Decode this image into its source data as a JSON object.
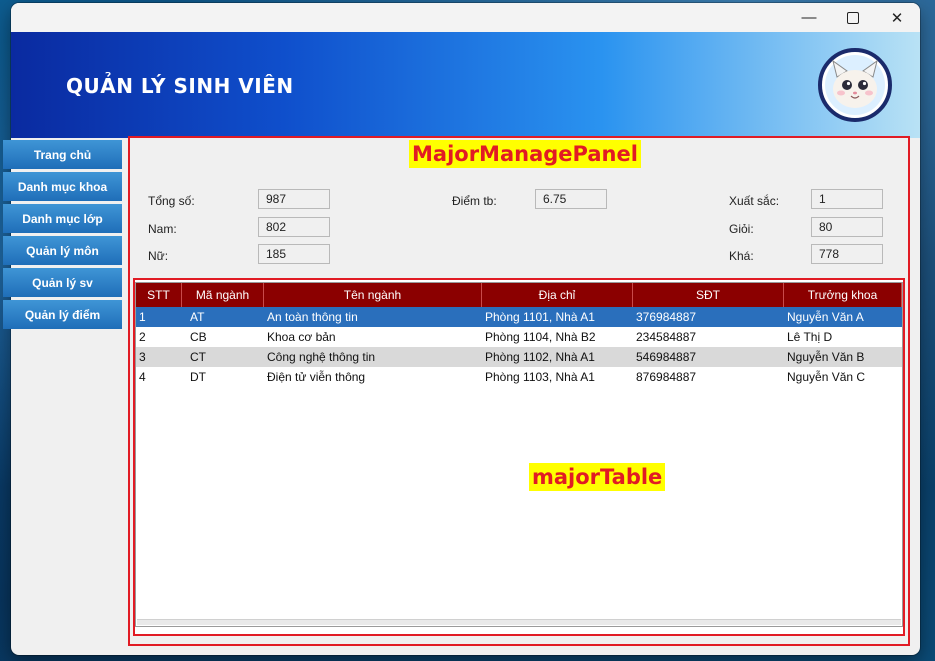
{
  "window": {
    "controls": {
      "minimize": "—",
      "close": "✕"
    }
  },
  "header": {
    "title": "QUẢN LÝ SINH VIÊN",
    "logo_icon": "cat-mascot-icon"
  },
  "sidebar": {
    "items": [
      {
        "label": "Trang chủ"
      },
      {
        "label": "Danh mục khoa"
      },
      {
        "label": "Danh mục lớp"
      },
      {
        "label": "Quản lý môn"
      },
      {
        "label": "Quản lý sv"
      },
      {
        "label": "Quản lý điểm"
      }
    ]
  },
  "annotations": {
    "panel": "MajorManagePanel",
    "table": "majorTable"
  },
  "stats": {
    "total_label": "Tổng số:",
    "total": "987",
    "male_label": "Nam:",
    "male": "802",
    "female_label": "Nữ:",
    "female": "185",
    "avg_label": "Điểm tb:",
    "avg": "6.75",
    "excellent_label": "Xuất sắc:",
    "excellent": "1",
    "good_label": "Giỏi:",
    "good": "80",
    "fair_label": "Khá:",
    "fair": "778"
  },
  "table": {
    "columns": [
      "STT",
      "Mã ngành",
      "Tên ngành",
      "Địa chỉ",
      "SĐT",
      "Trưởng khoa"
    ],
    "rows": [
      [
        "1",
        "AT",
        "An toàn thông tin",
        "Phòng 1101, Nhà A1",
        "376984887",
        "Nguyễn Văn A"
      ],
      [
        "2",
        "CB",
        "Khoa cơ bản",
        "Phòng 1104, Nhà B2",
        "234584887",
        "Lê Thị D"
      ],
      [
        "3",
        "CT",
        "Công nghệ thông tin",
        "Phòng 1102, Nhà A1",
        "546984887",
        "Nguyễn Văn B"
      ],
      [
        "4",
        "DT",
        "Điện tử viễn thông",
        "Phòng 1103, Nhà A1",
        "876984887",
        "Nguyễn Văn C"
      ]
    ],
    "selected_row": 0
  },
  "colors": {
    "header_bg": "#8b0000",
    "selected_row": "#2a6fbc",
    "annotation_border": "#e11b24",
    "annotation_bg": "#ffff00",
    "sidebar_button": "#1f6eb8"
  }
}
